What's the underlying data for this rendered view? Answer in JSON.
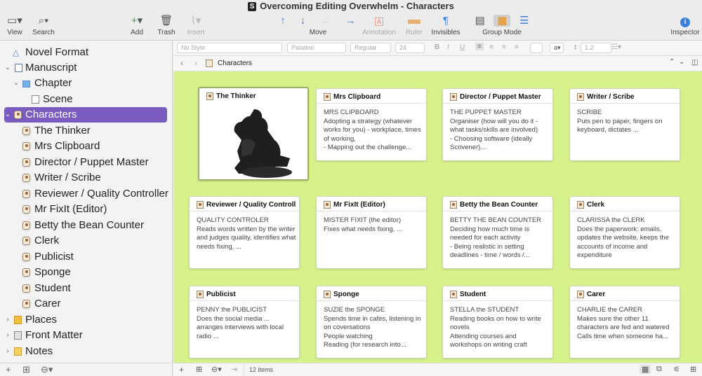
{
  "window": {
    "title": "Overcoming Editing Overwhelm - Characters",
    "app_badge": "S"
  },
  "toolbar": {
    "view": "View",
    "search": "Search",
    "add": "Add",
    "trash": "Trash",
    "insert": "Insert",
    "move": "Move",
    "annotation": "Annotation",
    "ruler": "Ruler",
    "invisibles": "Invisibles",
    "group_mode": "Group Mode",
    "inspector": "Inspector"
  },
  "binder": [
    {
      "label": "Novel Format"
    },
    {
      "label": "Manuscript"
    },
    {
      "label": "Chapter"
    },
    {
      "label": "Scene"
    },
    {
      "label": "Characters"
    },
    {
      "label": "The Thinker"
    },
    {
      "label": "Mrs Clipboard"
    },
    {
      "label": "Director / Puppet Master"
    },
    {
      "label": "Writer / Scribe"
    },
    {
      "label": "Reviewer / Quality Controller"
    },
    {
      "label": "Mr FixIt (Editor)"
    },
    {
      "label": "Betty the Bean Counter"
    },
    {
      "label": "Clerk"
    },
    {
      "label": "Publicist"
    },
    {
      "label": "Sponge"
    },
    {
      "label": "Student"
    },
    {
      "label": "Carer"
    },
    {
      "label": "Places"
    },
    {
      "label": "Front Matter"
    },
    {
      "label": "Notes"
    }
  ],
  "format_bar": {
    "style": "No Style",
    "font": "Palatino",
    "weight": "Regular",
    "size": "24",
    "spacing": "1.2"
  },
  "header": {
    "breadcrumb": "Characters"
  },
  "cards": [
    {
      "title": "The Thinker",
      "synopsis": ""
    },
    {
      "title": "Mrs Clipboard",
      "synopsis": "MRS CLIPBOARD\nAdopting a strategy (whatever works for you) - workplace, times of working,\n - Mapping out the challenge..."
    },
    {
      "title": "Director / Puppet Master",
      "synopsis": "THE PUPPET MASTER\nOrganiser (how will you do it - what tasks/skills are involved)\n - Choosing software (ideally Scrivener)..."
    },
    {
      "title": "Writer / Scribe",
      "synopsis": "SCRIBE\nPuts pen to paper, fingers on keyboard, dictates ..."
    },
    {
      "title": "Reviewer / Quality Controll...",
      "synopsis": "QUALITY CONTROLER\nReads words written by the writer and judges quality, identifies what needs fixing, ..."
    },
    {
      "title": "Mr FixIt (Editor)",
      "synopsis": "MISTER FIXIT (the editor)\nFixes what needs fixing, ..."
    },
    {
      "title": "Betty the Bean Counter",
      "synopsis": "BETTY THE BEAN COUNTER\nDeciding how much time is needed for each activity\n - Being realistic in setting deadlines - time / words /..."
    },
    {
      "title": "Clerk",
      "synopsis": "CLARISSA the CLERK\nDoes the paperwork: emails, updates the website, keeps the accounts of income and expenditure"
    },
    {
      "title": "Publicist",
      "synopsis": "PENNY the PUBLICIST\nDoes the social media ...\narranges interviews with local radio ..."
    },
    {
      "title": "Sponge",
      "synopsis": "SUZIE the SPONGE\nSpends time in cafes, listening in on coversations\nPeople watching\nReading (for research into..."
    },
    {
      "title": "Student",
      "synopsis": "STELLA the STUDENT\nReading books on how to write novels\nAttending courses and workshops on writing craft"
    },
    {
      "title": "Carer",
      "synopsis": "CHARLIE the CARER\nMakes sure the other 11 characters are fed and watered\nCalls time when someone ha..."
    }
  ],
  "footer": {
    "count": "12 items"
  },
  "colors": {
    "selection": "#7a5bbf",
    "corkboard": "#d7f28a",
    "accent": "#3a7ee0"
  }
}
